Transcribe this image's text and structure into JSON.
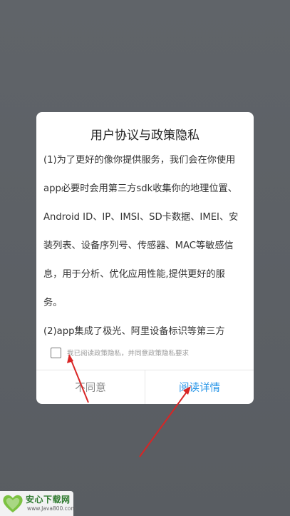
{
  "dialog": {
    "title": "用户协议与政策隐私",
    "body_lines": [
      "(1)为了更好的像你提供服务，我们会在你使用",
      "app必要时会用第三方sdk收集你的地理位置、",
      "Android ID、IP、IMSI、SD卡数据、IMEI、安",
      "装列表、设备序列号、传感器、MAC等敏感信",
      "息，用于分析、优化应用性能,提供更好的服",
      "务。",
      "(2)app集成了极光、阿里设备标识等第三方"
    ],
    "consent_label": "我已阅读政策隐私，并同意政策隐私要求",
    "consent_checked": false,
    "disagree_label": "不同意",
    "detail_label": "阅读详情"
  },
  "colors": {
    "overlay": "#5d6166",
    "dialog_bg": "#ffffff",
    "accent": "#2a97e8",
    "arrow": "#d92525"
  },
  "watermark": {
    "title": "安心下载网",
    "url": "www.Java800.com"
  }
}
